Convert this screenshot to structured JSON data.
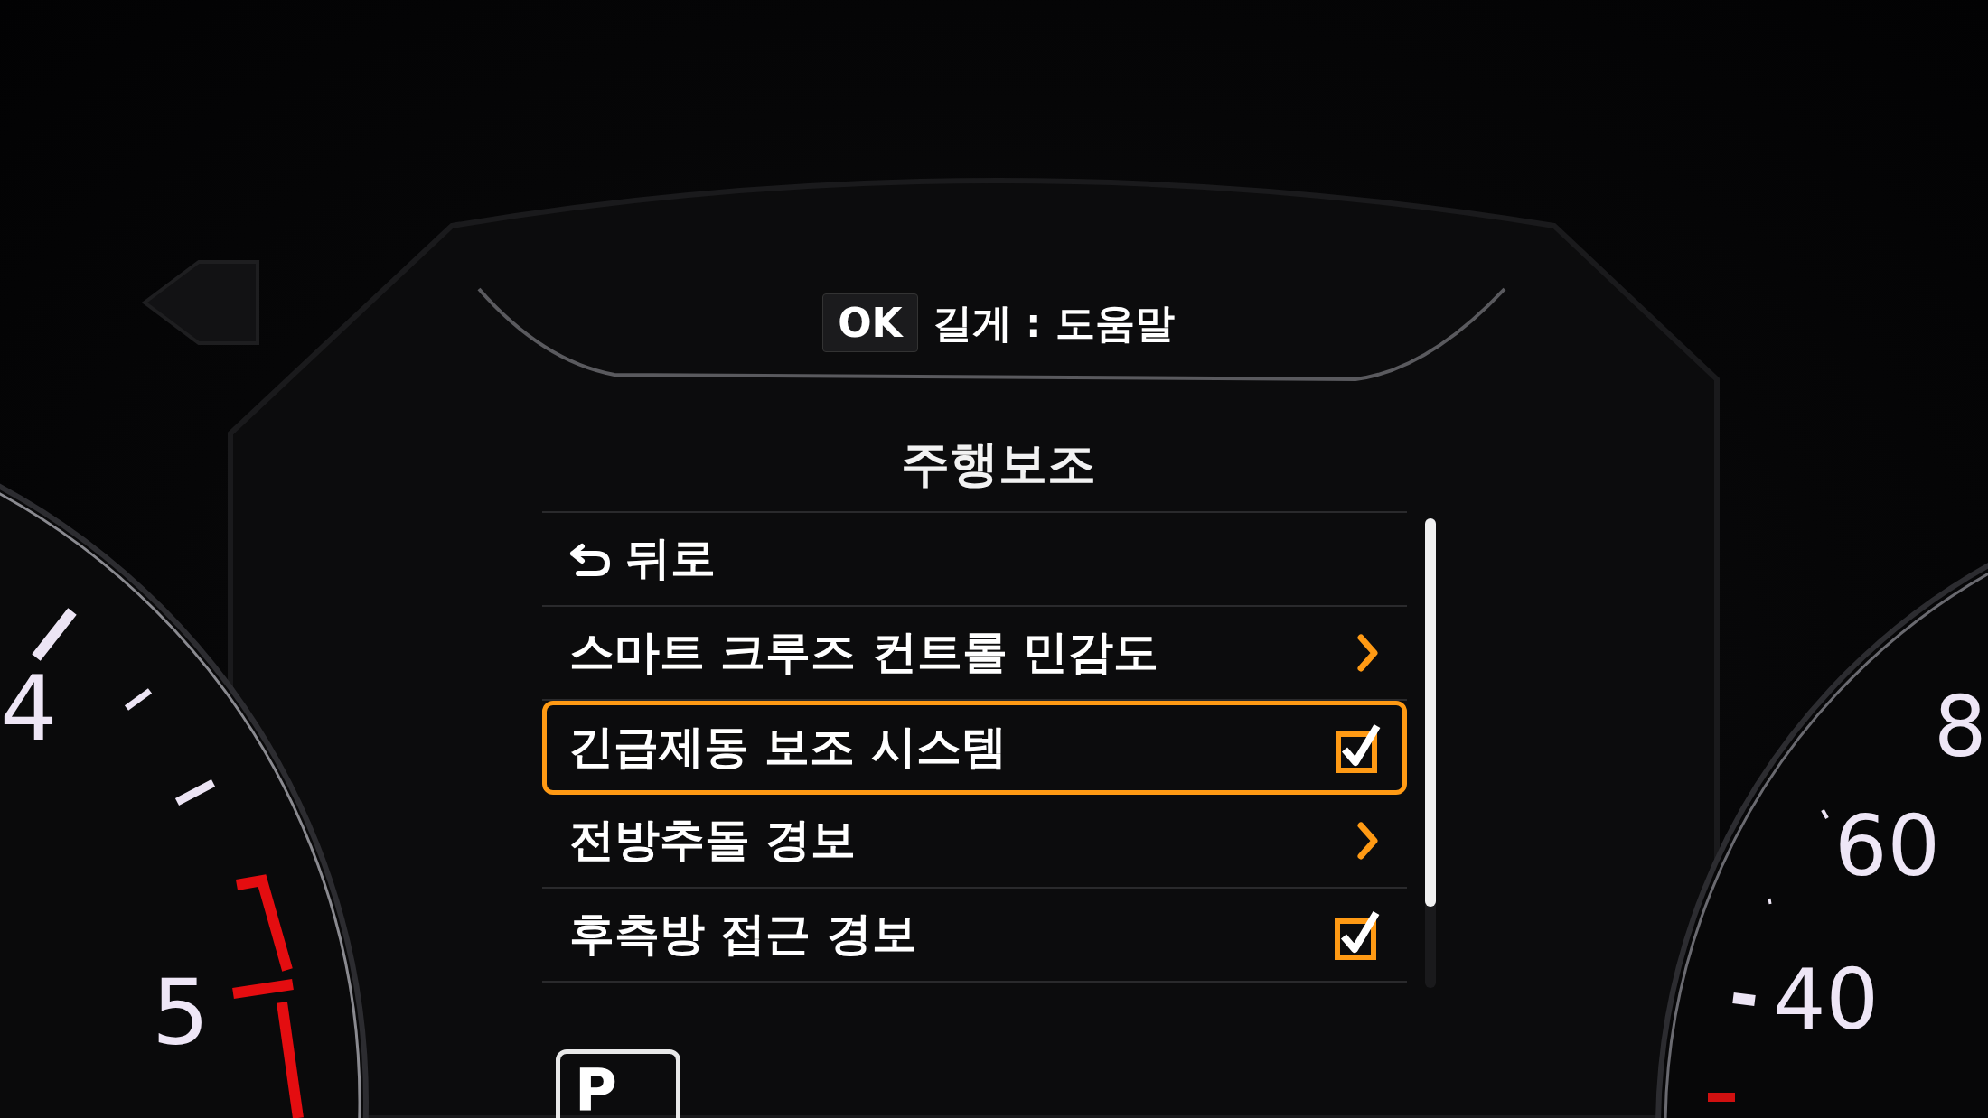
{
  "hint": {
    "key": "OK",
    "text": "길게 : 도움말"
  },
  "title": "주행보조",
  "menu": [
    {
      "kind": "back",
      "label": "뒤로",
      "selected": false
    },
    {
      "kind": "submenu",
      "label": "스마트 크루즈 컨트롤 민감도",
      "selected": false
    },
    {
      "kind": "toggle",
      "label": "긴급제동 보조 시스템",
      "checked": true,
      "selected": true
    },
    {
      "kind": "submenu",
      "label": "전방추돌 경보",
      "selected": false
    },
    {
      "kind": "toggle",
      "label": "후측방 접근 경보",
      "checked": true,
      "selected": false
    }
  ],
  "tachometer": {
    "labels": [
      "4",
      "5"
    ]
  },
  "speedometer": {
    "labels": [
      "8",
      "60",
      "40"
    ]
  },
  "gear": "P"
}
